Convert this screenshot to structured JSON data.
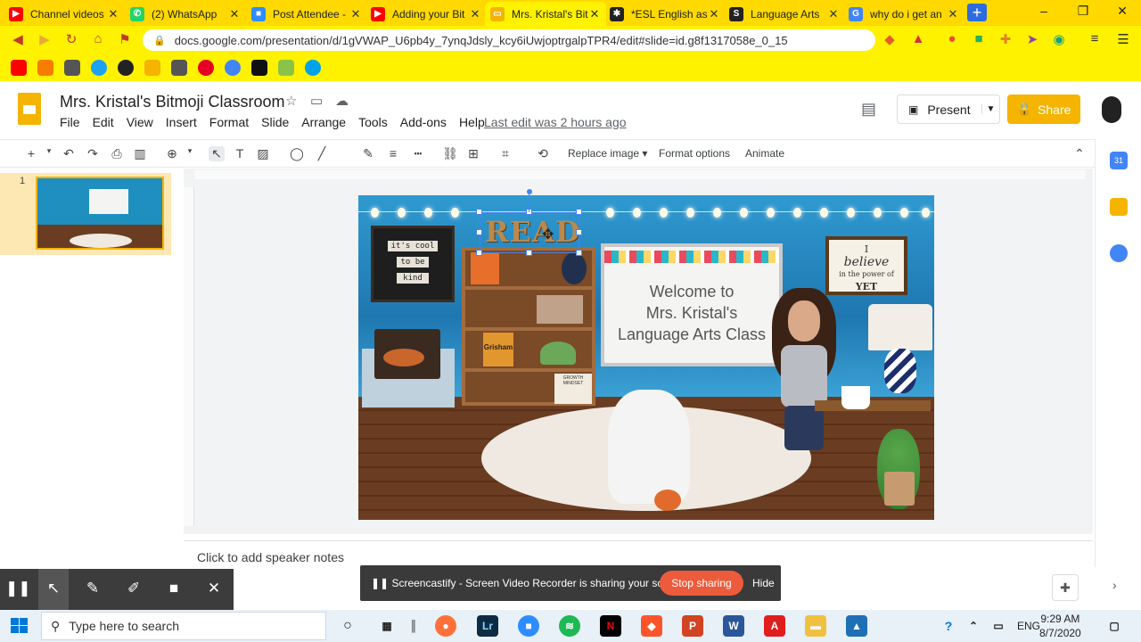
{
  "browser": {
    "tabs": [
      {
        "title": "Channel videos",
        "icon": "youtube-icon",
        "color": "#ff0000"
      },
      {
        "title": "(2) WhatsApp",
        "icon": "whatsapp-icon",
        "color": "#25d366"
      },
      {
        "title": "Post Attendee -",
        "icon": "zoom-icon",
        "color": "#2d8cff"
      },
      {
        "title": "Adding your Bit",
        "icon": "youtube-icon",
        "color": "#ff0000"
      },
      {
        "title": "Mrs. Kristal's Bit",
        "icon": "slides-icon",
        "color": "#f4b400",
        "active": true
      },
      {
        "title": "*ESL English as a",
        "icon": "paw-icon",
        "color": "#222222"
      },
      {
        "title": "Language Arts",
        "icon": "s-icon",
        "color": "#222222"
      },
      {
        "title": "why do i get an",
        "icon": "google-icon",
        "color": "#4285f4"
      }
    ],
    "new_tab_label": "+",
    "window_controls": {
      "minimize": "–",
      "maximize": "❐",
      "close": "✕"
    },
    "url": "docs.google.com/presentation/d/1gVWAP_U6pb4y_7ynqJdsly_kcy6iUwjoptrgalpTPR4/edit#slide=id.g8f1317058e_0_15",
    "accent": "#fff200"
  },
  "docs": {
    "title": "Mrs. Kristal's Bitmoji Classroom",
    "menu": [
      "File",
      "Edit",
      "View",
      "Insert",
      "Format",
      "Slide",
      "Arrange",
      "Tools",
      "Add-ons",
      "Help"
    ],
    "last_edit": "Last edit was 2 hours ago",
    "present_label": "Present",
    "share_label": "Share",
    "share_color": "#f4b400"
  },
  "toolbar": {
    "replace_image": "Replace image ▾",
    "format_options": "Format options",
    "animate": "Animate"
  },
  "filmstrip": {
    "slide_number": "1"
  },
  "slide": {
    "chalkboard": [
      "it's cool",
      "to be",
      "kind"
    ],
    "read_sign": "READ",
    "shelf_book": "Grisham",
    "shelf_card": "GROWTH MINDSET",
    "whiteboard_lines": [
      "Welcome to",
      "Mrs. Kristal's",
      "Language Arts Class"
    ],
    "believe_sign": [
      "I",
      "believe",
      "in the power of",
      "YET"
    ]
  },
  "notes": {
    "placeholder": "Click to add speaker notes"
  },
  "screencastify": {
    "message": "Screencastify - Screen Video Recorder is sharing your screen.",
    "stop_label": "Stop sharing",
    "hide_label": "Hide",
    "stop_color": "#ec5b3b"
  },
  "taskbar": {
    "search_placeholder": "Type here to search",
    "language": "ENG",
    "time": "9:29 AM",
    "date": "8/7/2020"
  }
}
